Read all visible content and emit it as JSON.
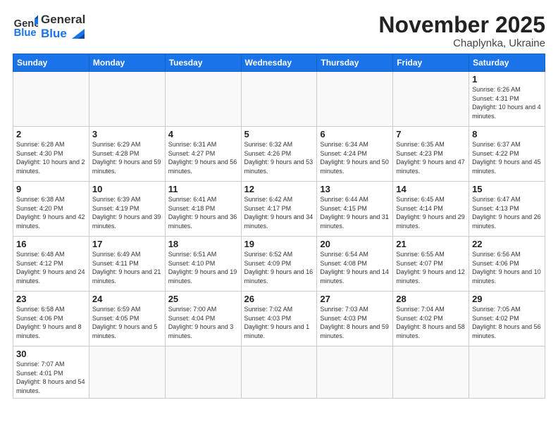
{
  "logo": {
    "line1": "General",
    "line2": "Blue"
  },
  "title": "November 2025",
  "subtitle": "Chaplynka, Ukraine",
  "weekdays": [
    "Sunday",
    "Monday",
    "Tuesday",
    "Wednesday",
    "Thursday",
    "Friday",
    "Saturday"
  ],
  "weeks": [
    [
      {
        "day": "",
        "info": ""
      },
      {
        "day": "",
        "info": ""
      },
      {
        "day": "",
        "info": ""
      },
      {
        "day": "",
        "info": ""
      },
      {
        "day": "",
        "info": ""
      },
      {
        "day": "",
        "info": ""
      },
      {
        "day": "1",
        "info": "Sunrise: 6:26 AM\nSunset: 4:31 PM\nDaylight: 10 hours\nand 4 minutes."
      }
    ],
    [
      {
        "day": "2",
        "info": "Sunrise: 6:28 AM\nSunset: 4:30 PM\nDaylight: 10 hours\nand 2 minutes."
      },
      {
        "day": "3",
        "info": "Sunrise: 6:29 AM\nSunset: 4:28 PM\nDaylight: 9 hours\nand 59 minutes."
      },
      {
        "day": "4",
        "info": "Sunrise: 6:31 AM\nSunset: 4:27 PM\nDaylight: 9 hours\nand 56 minutes."
      },
      {
        "day": "5",
        "info": "Sunrise: 6:32 AM\nSunset: 4:26 PM\nDaylight: 9 hours\nand 53 minutes."
      },
      {
        "day": "6",
        "info": "Sunrise: 6:34 AM\nSunset: 4:24 PM\nDaylight: 9 hours\nand 50 minutes."
      },
      {
        "day": "7",
        "info": "Sunrise: 6:35 AM\nSunset: 4:23 PM\nDaylight: 9 hours\nand 47 minutes."
      },
      {
        "day": "8",
        "info": "Sunrise: 6:37 AM\nSunset: 4:22 PM\nDaylight: 9 hours\nand 45 minutes."
      }
    ],
    [
      {
        "day": "9",
        "info": "Sunrise: 6:38 AM\nSunset: 4:20 PM\nDaylight: 9 hours\nand 42 minutes."
      },
      {
        "day": "10",
        "info": "Sunrise: 6:39 AM\nSunset: 4:19 PM\nDaylight: 9 hours\nand 39 minutes."
      },
      {
        "day": "11",
        "info": "Sunrise: 6:41 AM\nSunset: 4:18 PM\nDaylight: 9 hours\nand 36 minutes."
      },
      {
        "day": "12",
        "info": "Sunrise: 6:42 AM\nSunset: 4:17 PM\nDaylight: 9 hours\nand 34 minutes."
      },
      {
        "day": "13",
        "info": "Sunrise: 6:44 AM\nSunset: 4:15 PM\nDaylight: 9 hours\nand 31 minutes."
      },
      {
        "day": "14",
        "info": "Sunrise: 6:45 AM\nSunset: 4:14 PM\nDaylight: 9 hours\nand 29 minutes."
      },
      {
        "day": "15",
        "info": "Sunrise: 6:47 AM\nSunset: 4:13 PM\nDaylight: 9 hours\nand 26 minutes."
      }
    ],
    [
      {
        "day": "16",
        "info": "Sunrise: 6:48 AM\nSunset: 4:12 PM\nDaylight: 9 hours\nand 24 minutes."
      },
      {
        "day": "17",
        "info": "Sunrise: 6:49 AM\nSunset: 4:11 PM\nDaylight: 9 hours\nand 21 minutes."
      },
      {
        "day": "18",
        "info": "Sunrise: 6:51 AM\nSunset: 4:10 PM\nDaylight: 9 hours\nand 19 minutes."
      },
      {
        "day": "19",
        "info": "Sunrise: 6:52 AM\nSunset: 4:09 PM\nDaylight: 9 hours\nand 16 minutes."
      },
      {
        "day": "20",
        "info": "Sunrise: 6:54 AM\nSunset: 4:08 PM\nDaylight: 9 hours\nand 14 minutes."
      },
      {
        "day": "21",
        "info": "Sunrise: 6:55 AM\nSunset: 4:07 PM\nDaylight: 9 hours\nand 12 minutes."
      },
      {
        "day": "22",
        "info": "Sunrise: 6:56 AM\nSunset: 4:06 PM\nDaylight: 9 hours\nand 10 minutes."
      }
    ],
    [
      {
        "day": "23",
        "info": "Sunrise: 6:58 AM\nSunset: 4:06 PM\nDaylight: 9 hours\nand 8 minutes."
      },
      {
        "day": "24",
        "info": "Sunrise: 6:59 AM\nSunset: 4:05 PM\nDaylight: 9 hours\nand 5 minutes."
      },
      {
        "day": "25",
        "info": "Sunrise: 7:00 AM\nSunset: 4:04 PM\nDaylight: 9 hours\nand 3 minutes."
      },
      {
        "day": "26",
        "info": "Sunrise: 7:02 AM\nSunset: 4:03 PM\nDaylight: 9 hours\nand 1 minute."
      },
      {
        "day": "27",
        "info": "Sunrise: 7:03 AM\nSunset: 4:03 PM\nDaylight: 8 hours\nand 59 minutes."
      },
      {
        "day": "28",
        "info": "Sunrise: 7:04 AM\nSunset: 4:02 PM\nDaylight: 8 hours\nand 58 minutes."
      },
      {
        "day": "29",
        "info": "Sunrise: 7:05 AM\nSunset: 4:02 PM\nDaylight: 8 hours\nand 56 minutes."
      }
    ],
    [
      {
        "day": "30",
        "info": "Sunrise: 7:07 AM\nSunset: 4:01 PM\nDaylight: 8 hours\nand 54 minutes."
      },
      {
        "day": "",
        "info": ""
      },
      {
        "day": "",
        "info": ""
      },
      {
        "day": "",
        "info": ""
      },
      {
        "day": "",
        "info": ""
      },
      {
        "day": "",
        "info": ""
      },
      {
        "day": "",
        "info": ""
      }
    ]
  ]
}
